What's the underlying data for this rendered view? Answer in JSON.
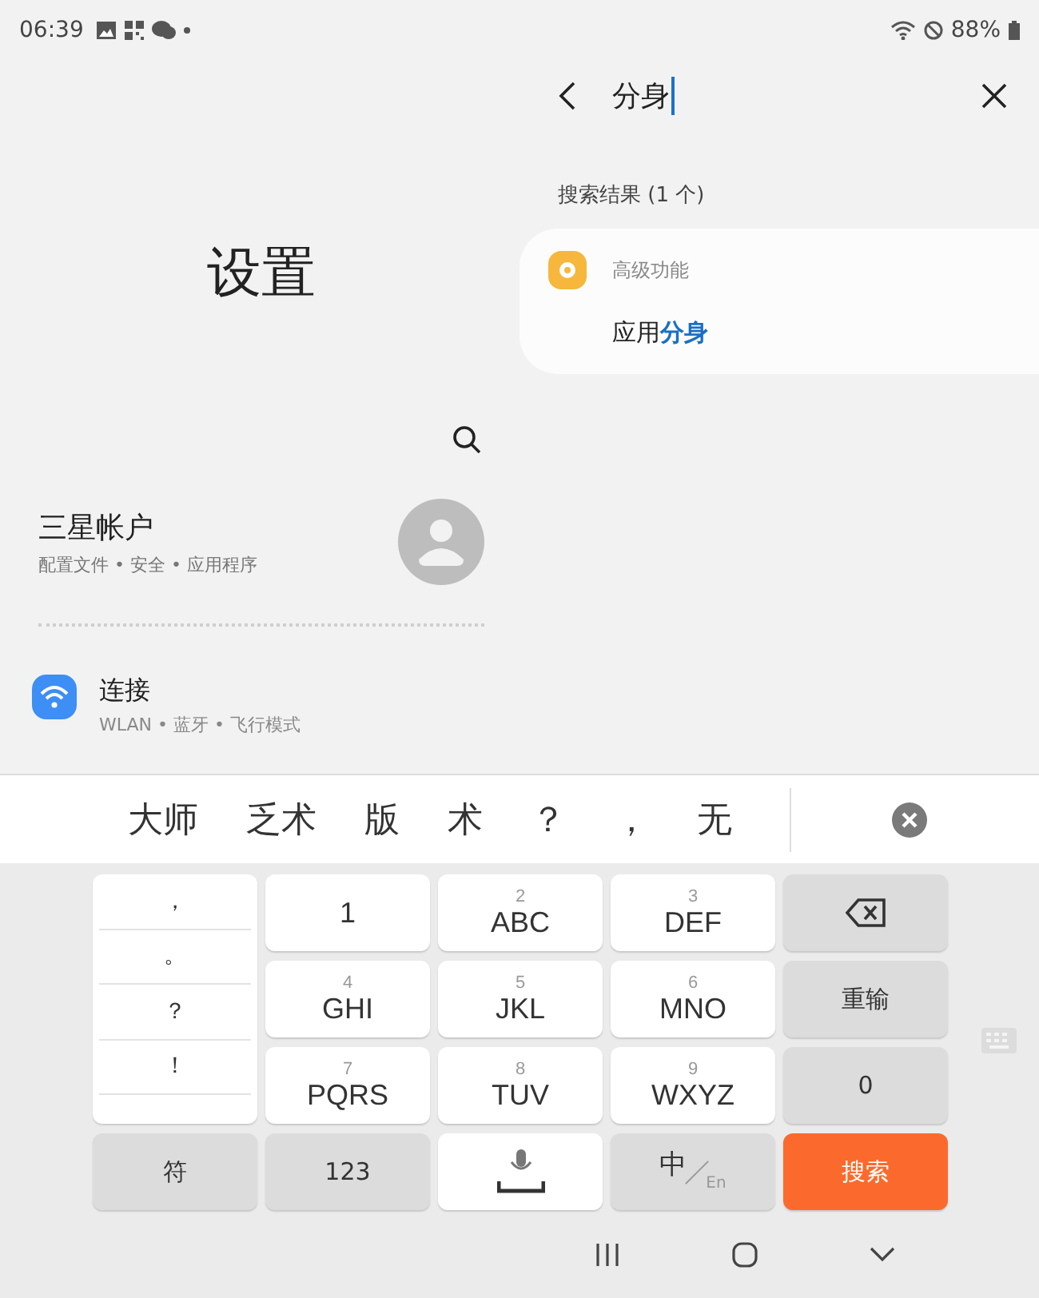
{
  "status_bar": {
    "time": "06:39",
    "battery": "88%"
  },
  "settings": {
    "title": "设置",
    "account": {
      "name": "三星帐户",
      "subtitle": "配置文件 • 安全 • 应用程序"
    },
    "items": [
      {
        "title": "连接",
        "subtitle": "WLAN • 蓝牙 • 飞行模式"
      }
    ]
  },
  "search": {
    "query": "分身",
    "results_label": "搜索结果 (1 个)",
    "results": [
      {
        "category": "高级功能",
        "title": "应用**分身**"
      }
    ]
  },
  "candidates": [
    "大师",
    "乏术",
    "版",
    "术",
    "？",
    "，",
    "无"
  ],
  "keyboard": {
    "punctuation": [
      "，",
      "。",
      "？",
      "！"
    ],
    "keys": [
      {
        "kind": "letter",
        "label": "1"
      },
      {
        "kind": "letter",
        "digit": "2",
        "label": "ABC"
      },
      {
        "kind": "letter",
        "digit": "3",
        "label": "DEF"
      },
      {
        "kind": "backspace"
      },
      {
        "kind": "letter",
        "digit": "4",
        "label": "GHI"
      },
      {
        "kind": "letter",
        "digit": "5",
        "label": "JKL"
      },
      {
        "kind": "letter",
        "digit": "6",
        "label": "MNO"
      },
      {
        "kind": "func",
        "label": "重输"
      },
      {
        "kind": "letter",
        "digit": "7",
        "label": "PQRS"
      },
      {
        "kind": "letter",
        "digit": "8",
        "label": "TUV"
      },
      {
        "kind": "letter",
        "digit": "9",
        "label": "WXYZ"
      },
      {
        "kind": "func",
        "label": "0"
      },
      {
        "kind": "func",
        "label": "符"
      },
      {
        "kind": "func",
        "label": "123"
      },
      {
        "kind": "mic"
      },
      {
        "kind": "lang",
        "label": "中",
        "sub": "En"
      },
      {
        "kind": "enter",
        "label": "搜索"
      }
    ]
  }
}
